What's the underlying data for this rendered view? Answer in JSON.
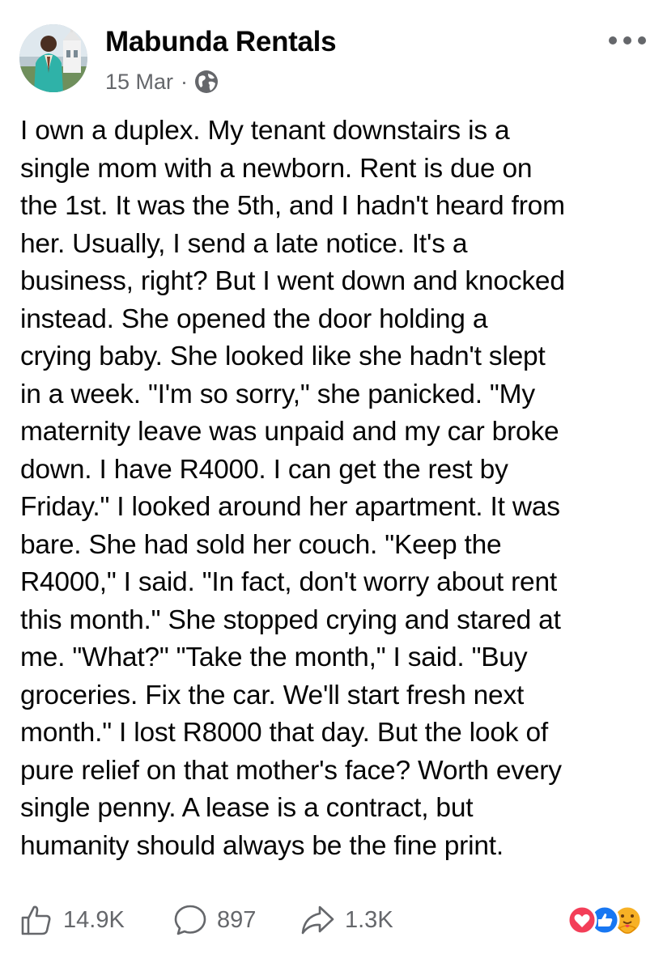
{
  "post": {
    "author": "Mabunda Rentals",
    "date": "15 Mar",
    "separator": "·",
    "privacy_icon": "globe-icon",
    "more_icon": "more-options-icon",
    "body_lines": [
      "I own a duplex. My tenant downstairs is a",
      "single mom with a newborn. Rent is due on",
      "the 1st. It was the 5th, and I hadn't heard from",
      "her. Usually, I send a late notice. It's a",
      "business, right? But I went down and knocked",
      "instead. She opened the door holding a",
      "crying baby. She looked like she hadn't slept",
      "in a week. \"I'm so sorry,\" she panicked. \"My",
      "maternity leave was unpaid and my car broke",
      "down. I have R4000. I can get the rest by",
      "Friday.\" I looked around her apartment. It was",
      "bare. She had sold her couch. \"Keep the",
      "R4000,\" I said. \"In fact, don't worry about rent",
      "this month.\" She stopped crying and stared at",
      "me. \"What?\" \"Take the month,\" I said. \"Buy",
      "groceries. Fix the car. We'll start fresh next",
      "month.\" I lost R8000 that day. But the look of",
      "pure relief on that mother's face? Worth every",
      "single penny. A lease is a contract, but",
      "humanity should always be the fine print."
    ]
  },
  "footer": {
    "likes": "14.9K",
    "comments": "897",
    "shares": "1.3K",
    "like_icon": "thumbs-up-icon",
    "comment_icon": "comment-bubble-icon",
    "share_icon": "share-arrow-icon",
    "reactions": [
      "love-reaction-icon",
      "like-reaction-icon",
      "care-reaction-icon"
    ]
  },
  "colors": {
    "text": "#050505",
    "secondary": "#65676b",
    "like_blue": "#1877f2",
    "love_red": "#f33e58",
    "care_yellow": "#f7b125"
  }
}
